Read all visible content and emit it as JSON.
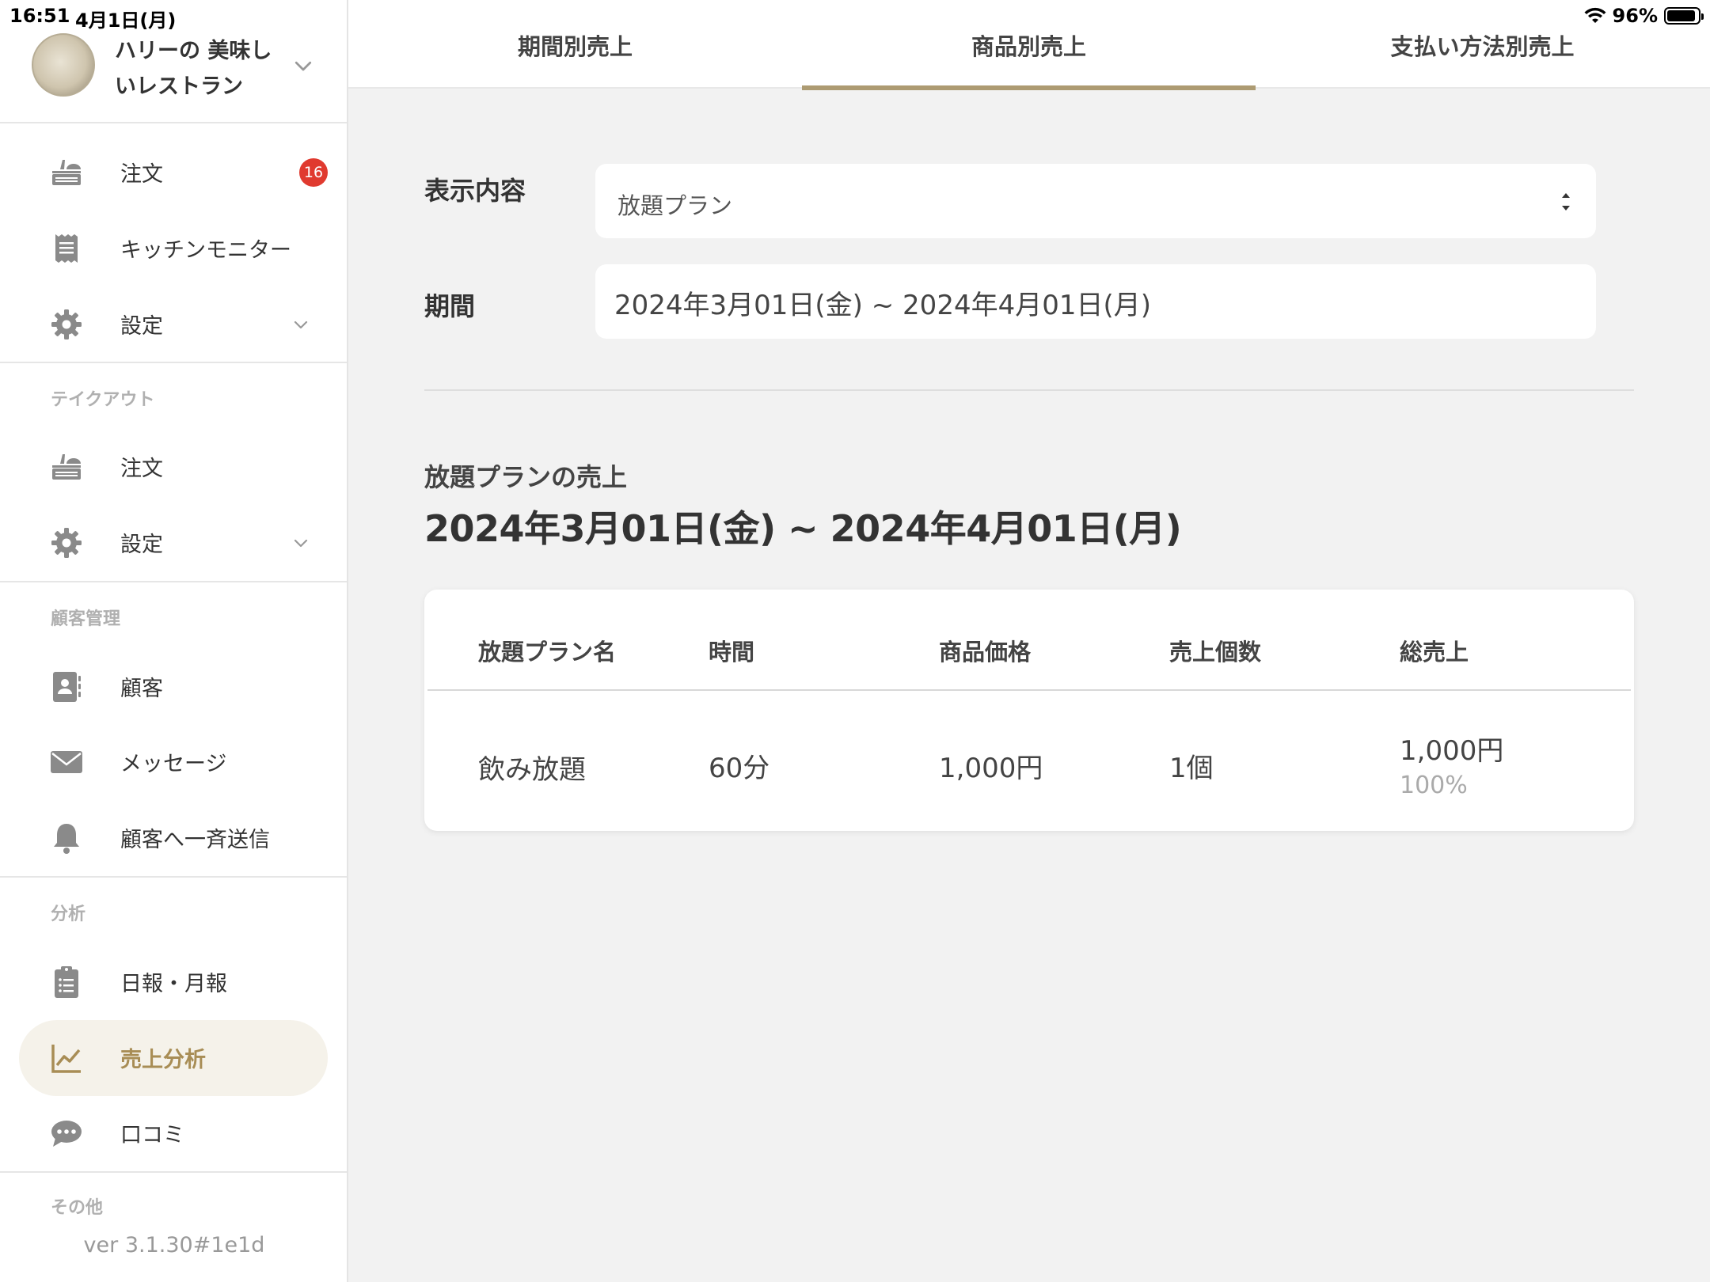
{
  "status_bar": {
    "time": "16:51",
    "date": "4月1日(月)",
    "battery": "96%",
    "battery_level": 0.96
  },
  "store": {
    "name": "ハリーの 美味しいレストラン"
  },
  "sidebar": {
    "top_items": [
      {
        "label": "注文",
        "badge": "16"
      },
      {
        "label": "キッチンモニター"
      },
      {
        "label": "設定"
      }
    ],
    "sections": [
      {
        "title": "テイクアウト",
        "items": [
          {
            "label": "注文"
          },
          {
            "label": "設定"
          }
        ]
      },
      {
        "title": "顧客管理",
        "items": [
          {
            "label": "顧客"
          },
          {
            "label": "メッセージ"
          },
          {
            "label": "顧客へ一斉送信"
          }
        ]
      },
      {
        "title": "分析",
        "items": [
          {
            "label": "日報・月報"
          },
          {
            "label": "売上分析"
          },
          {
            "label": "口コミ"
          }
        ]
      },
      {
        "title": "その他"
      }
    ],
    "version": "ver 3.1.30#1e1d"
  },
  "tabs": [
    {
      "label": "期間別売上"
    },
    {
      "label": "商品別売上"
    },
    {
      "label": "支払い方法別売上"
    }
  ],
  "form": {
    "display_label": "表示内容",
    "display_value": "放題プラン",
    "period_label": "期間",
    "period_value": "2024年3月01日(金) ~ 2024年4月01日(月)"
  },
  "results": {
    "subtitle": "放題プランの売上",
    "period": "2024年3月01日(金) ~ 2024年4月01日(月)",
    "columns": [
      "放題プラン名",
      "時間",
      "商品価格",
      "売上個数",
      "総売上"
    ],
    "rows": [
      {
        "name": "飲み放題",
        "time": "60分",
        "price": "1,000円",
        "qty": "1個",
        "total": "1,000円",
        "share": "100%"
      }
    ]
  },
  "colors": {
    "accent": "#ad9b72",
    "accent_text": "#a88d55",
    "badge": "#e03a2f",
    "icon": "#8a8a8a"
  }
}
